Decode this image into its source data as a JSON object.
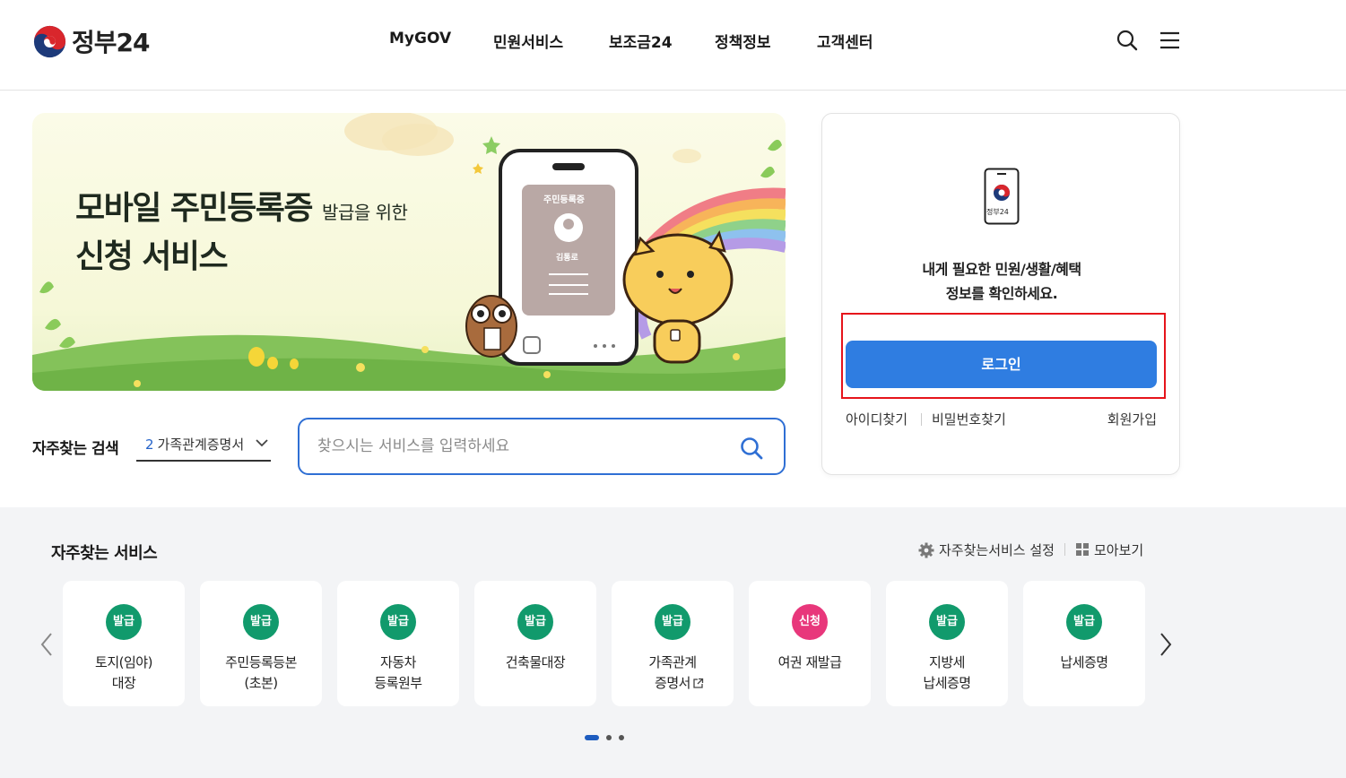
{
  "header": {
    "logo_text": "정부24",
    "nav": [
      "MyGOV",
      "민원서비스",
      "보조금24",
      "정책정보",
      "고객센터"
    ],
    "search_icon": "search-icon",
    "menu_icon": "hamburger-menu-icon"
  },
  "banner": {
    "title_line1": "모바일 주민등록증",
    "title_suffix": "발급을 위한",
    "title_line2": "신청 서비스",
    "card_title": "주민등록증",
    "card_name": "김통로"
  },
  "search": {
    "label": "자주찾는 검색",
    "selected_rank": "2",
    "selected_value": "가족관계증명서",
    "placeholder": "찾으시는 서비스를 입력하세요"
  },
  "login": {
    "app_label": "정부24",
    "message_line1": "내게 필요한 민원/생활/혜택",
    "message_line2": "정보를 확인하세요.",
    "login_button": "로그인",
    "find_id": "아이디찾기",
    "find_pw": "비밀번호찾기",
    "signup": "회원가입"
  },
  "services": {
    "title": "자주찾는 서비스",
    "settings_label": "자주찾는서비스 설정",
    "view_all_label": "모아보기",
    "items": [
      {
        "badge": "발급",
        "label": "토지(임야)\n대장",
        "type": "issue"
      },
      {
        "badge": "발급",
        "label": "주민등록등본\n(초본)",
        "type": "issue"
      },
      {
        "badge": "발급",
        "label": "자동차\n등록원부",
        "type": "issue"
      },
      {
        "badge": "발급",
        "label": "건축물대장",
        "type": "issue"
      },
      {
        "badge": "발급",
        "label": "가족관계\n증명서",
        "type": "issue"
      },
      {
        "badge": "신청",
        "label": "여권 재발급",
        "type": "apply"
      },
      {
        "badge": "발급",
        "label": "지방세\n납세증명",
        "type": "issue"
      },
      {
        "badge": "발급",
        "label": "납세증명",
        "type": "issue"
      }
    ],
    "page_count": 3,
    "current_page": 1
  },
  "colors": {
    "primary_blue": "#2f7de1",
    "issue_green": "#119a6c",
    "apply_pink": "#e8377b",
    "highlight_red": "#e6141b"
  }
}
